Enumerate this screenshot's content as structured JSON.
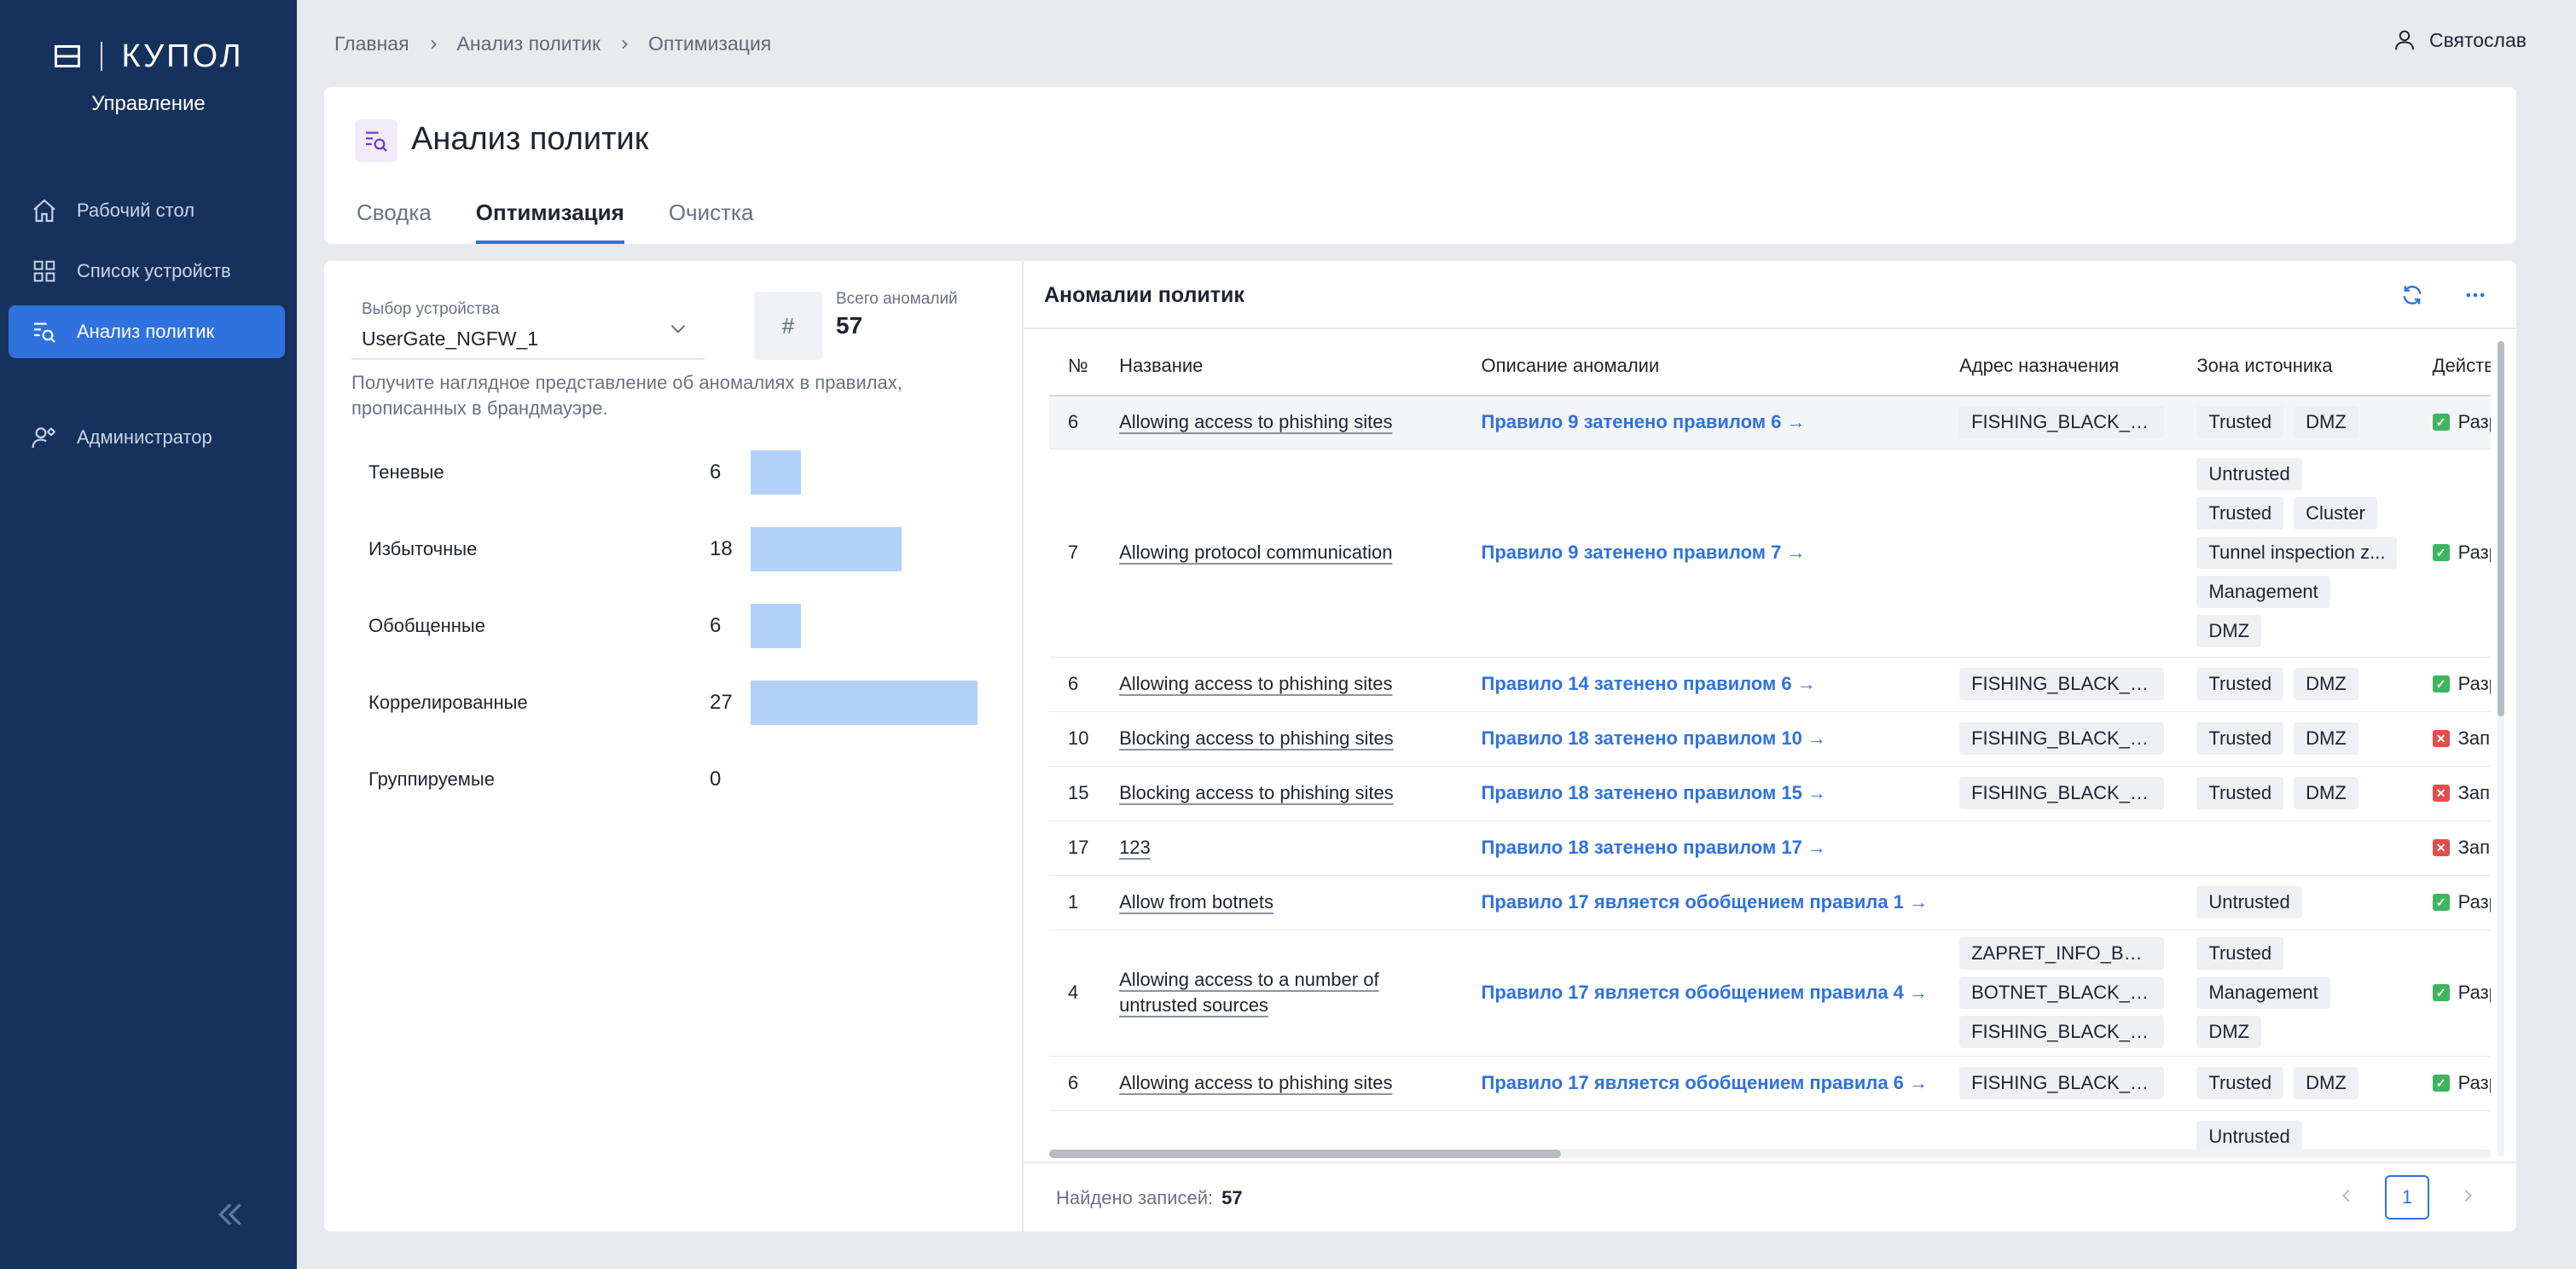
{
  "sidebar": {
    "logo_mark": "Н",
    "logo_text": "КУПОЛ",
    "subtitle": "Управление",
    "items": [
      {
        "label": "Рабочий стол",
        "icon": "home-icon"
      },
      {
        "label": "Список устройств",
        "icon": "grid-icon"
      },
      {
        "label": "Анализ политик",
        "icon": "list-search-icon"
      },
      {
        "label": "Администратор",
        "icon": "user-gear-icon"
      }
    ],
    "collapse": "«"
  },
  "breadcrumb": [
    "Главная",
    "Анализ политик",
    "Оптимизация"
  ],
  "user": {
    "name": "Святослав"
  },
  "page": {
    "title": "Анализ политик",
    "tabs": [
      "Сводка",
      "Оптимизация",
      "Очистка"
    ],
    "active_tab": "Оптимизация"
  },
  "left": {
    "device_label": "Выбор устройства",
    "device_value": "UserGate_NGFW_1",
    "total_symbol": "#",
    "total_label": "Всего аномалий",
    "total_value": "57",
    "hint": "Получите наглядное представление об аномалиях в правилах, прописанных в брандмауэре.",
    "stats": [
      {
        "name": "Теневые",
        "count": 6
      },
      {
        "name": "Избыточные",
        "count": 18
      },
      {
        "name": "Обобщенные",
        "count": 6
      },
      {
        "name": "Коррелированные",
        "count": 27
      },
      {
        "name": "Группируемые",
        "count": 0
      }
    ],
    "stats_max": 27
  },
  "right": {
    "title": "Аномалии политик",
    "columns": [
      "№",
      "Название",
      "Описание аномалии",
      "Адрес назначения",
      "Зона источника",
      "Действие"
    ],
    "rows": [
      {
        "num": "6",
        "name": [
          "Allowing access to phishing sites"
        ],
        "desc": "Правило 9 затенено правилом 6 →",
        "dest": [
          "FISHING_BLACK_LI..."
        ],
        "zones": [
          [
            "Trusted",
            "DMZ"
          ]
        ],
        "action": "Разрешить",
        "action_type": "ok",
        "highlight": true
      },
      {
        "num": "7",
        "name": [
          "Allowing protocol communication"
        ],
        "desc": "Правило 9 затенено правилом 7 →",
        "dest": [],
        "zones": [
          [
            "Untrusted"
          ],
          [
            "Trusted",
            "Cluster"
          ],
          [
            "Tunnel inspection z..."
          ],
          [
            "Management"
          ],
          [
            "DMZ"
          ]
        ],
        "action": "Разрешить",
        "action_type": "ok"
      },
      {
        "num": "6",
        "name": [
          "Allowing access to phishing sites"
        ],
        "desc": "Правило 14 затенено правилом 6 →",
        "dest": [
          "FISHING_BLACK_LI..."
        ],
        "zones": [
          [
            "Trusted",
            "DMZ"
          ]
        ],
        "action": "Разрешить",
        "action_type": "ok"
      },
      {
        "num": "10",
        "name": [
          "Blocking access to phishing sites"
        ],
        "desc": "Правило 18 затенено правилом 10 →",
        "dest": [
          "FISHING_BLACK_LI..."
        ],
        "zones": [
          [
            "Trusted",
            "DMZ"
          ]
        ],
        "action": "Запретить",
        "action_type": "no"
      },
      {
        "num": "15",
        "name": [
          "Blocking access to phishing sites"
        ],
        "desc": "Правило 18 затенено правилом 15 →",
        "dest": [
          "FISHING_BLACK_LI..."
        ],
        "zones": [
          [
            "Trusted",
            "DMZ"
          ]
        ],
        "action": "Запретить",
        "action_type": "no"
      },
      {
        "num": "17",
        "name": [
          "123"
        ],
        "desc": "Правило 18 затенено правилом 17 →",
        "dest": [],
        "zones": [],
        "action": "Запретить",
        "action_type": "no"
      },
      {
        "num": "1",
        "name": [
          "Allow from botnets"
        ],
        "desc": "Правило 17 является обобщением правила 1 →",
        "dest": [],
        "zones": [
          [
            "Untrusted"
          ]
        ],
        "action": "Разрешить",
        "action_type": "ok"
      },
      {
        "num": "4",
        "name": [
          "Allowing access to a number of",
          "untrusted sources"
        ],
        "desc": "Правило 17 является обобщением правила 4 →",
        "dest": [
          "ZAPRET_INFO_BLA...",
          "BOTNET_BLACK_LI...",
          "FISHING_BLACK_LI..."
        ],
        "zones": [
          [
            "Trusted"
          ],
          [
            "Management"
          ],
          [
            "DMZ"
          ]
        ],
        "action": "Разрешить",
        "action_type": "ok"
      },
      {
        "num": "6",
        "name": [
          "Allowing access to phishing sites"
        ],
        "desc": "Правило 17 является обобщением правила 6 →",
        "dest": [
          "FISHING_BLACK_LI..."
        ],
        "zones": [
          [
            "Trusted",
            "DMZ"
          ]
        ],
        "action": "Разрешить",
        "action_type": "ok"
      },
      {
        "num": "",
        "name": [],
        "desc": "",
        "dest": [],
        "zones": [
          [
            "Untrusted"
          ]
        ],
        "action": "",
        "action_type": ""
      }
    ],
    "found_label": "Найдено записей:",
    "found_value": "57",
    "page": "1"
  },
  "colors": {
    "sidebar": "#16325C",
    "accent": "#2F72DE",
    "bar": "#B2D2FA",
    "ok": "#3FB561",
    "deny": "#E0504A"
  }
}
